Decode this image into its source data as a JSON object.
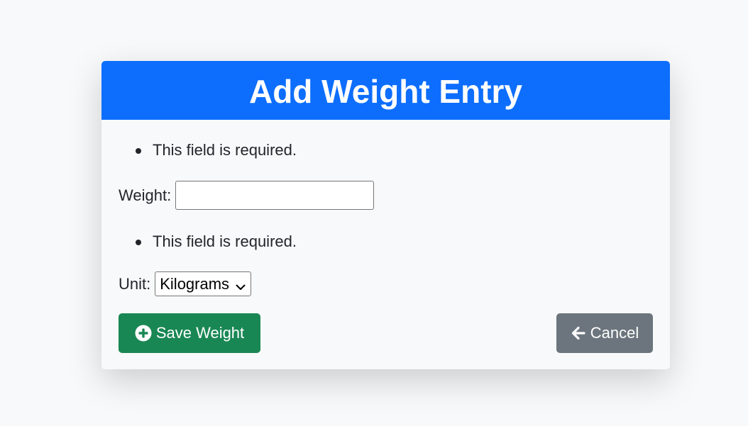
{
  "header": {
    "title": "Add Weight Entry"
  },
  "form": {
    "weight_error": "This field is required.",
    "weight_label": "Weight:",
    "weight_value": "",
    "unit_error": "This field is required.",
    "unit_label": "Unit:",
    "unit_selected": "Kilograms"
  },
  "actions": {
    "save_label": "Save Weight",
    "save_icon": "plus-circle-icon",
    "cancel_label": "Cancel",
    "cancel_icon": "arrow-left-icon"
  },
  "colors": {
    "header_bg": "#0d6efd",
    "save_bg": "#198754",
    "cancel_bg": "#6c757d",
    "page_bg": "#f8f9fa"
  }
}
